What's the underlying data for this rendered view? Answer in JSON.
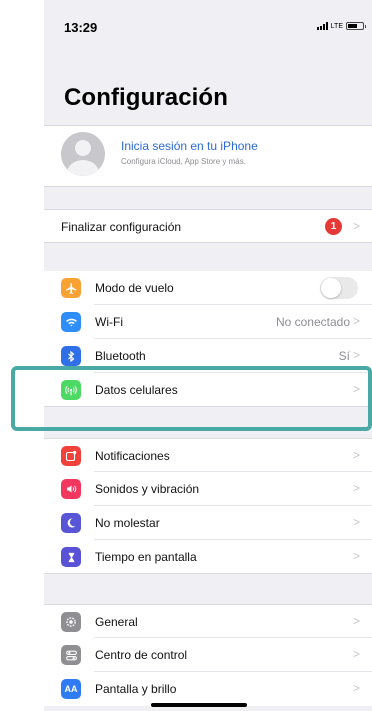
{
  "status_bar": {
    "time": "13:29",
    "network": "LTE"
  },
  "title": "Configuración",
  "profile": {
    "title": "Inicia sesión en tu iPhone",
    "subtitle": "Configura iCloud, App Store y más."
  },
  "finish_setup": {
    "label": "Finalizar configuración",
    "badge": "1"
  },
  "connectivity": [
    {
      "label": "Modo de vuelo",
      "value": "",
      "icon": "airplane-icon",
      "color": "#f7a233"
    },
    {
      "label": "Wi-Fi",
      "value": "No conectado",
      "icon": "wifi-icon",
      "color": "#2f8dfa"
    },
    {
      "label": "Bluetooth",
      "value": "Sí",
      "icon": "bluetooth-icon",
      "color": "#2f6fe8"
    },
    {
      "label": "Datos celulares",
      "value": "",
      "icon": "cellular-antenna-icon",
      "color": "#4cd964"
    }
  ],
  "notifications_group": [
    {
      "label": "Notificaciones",
      "icon": "notifications-icon",
      "color": "#f2413b"
    },
    {
      "label": "Sonidos y vibración",
      "icon": "speaker-icon",
      "color": "#f2375e"
    },
    {
      "label": "No molestar",
      "icon": "moon-icon",
      "color": "#5856d6"
    },
    {
      "label": "Tiempo en pantalla",
      "icon": "hourglass-icon",
      "color": "#5a52d6"
    }
  ],
  "general_group": [
    {
      "label": "General",
      "icon": "gear-icon",
      "color": "#8e8e93"
    },
    {
      "label": "Centro de control",
      "icon": "toggles-icon",
      "color": "#8e8e93"
    },
    {
      "label": "Pantalla y brillo",
      "icon": "display-aa-icon",
      "color": "#2f7bf5",
      "glyph": "AA"
    }
  ],
  "airplane_mode_on": false,
  "highlight_color": "#4aa9a4"
}
